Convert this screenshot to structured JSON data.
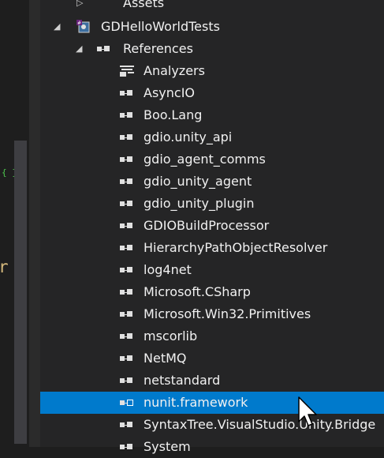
{
  "tree": {
    "assets": "Assets",
    "project": "GDHelloWorldTests",
    "references": "References",
    "items": [
      "Analyzers",
      "AsyncIO",
      "Boo.Lang",
      "gdio.unity_api",
      "gdio_agent_comms",
      "gdio_unity_agent",
      "gdio_unity_plugin",
      "GDIOBuildProcessor",
      "HierarchyPathObjectResolver",
      "log4net",
      "Microsoft.CSharp",
      "Microsoft.Win32.Primitives",
      "mscorlib",
      "NetMQ",
      "netstandard",
      "nunit.framework",
      "SyntaxTree.VisualStudio.Unity.Bridge",
      "System"
    ],
    "selected": "nunit.framework"
  },
  "editor": {
    "char": "r",
    "mark": "{ }"
  },
  "colors": {
    "selection": "#007acc",
    "background": "#252526",
    "folder": "#dcb67a"
  }
}
